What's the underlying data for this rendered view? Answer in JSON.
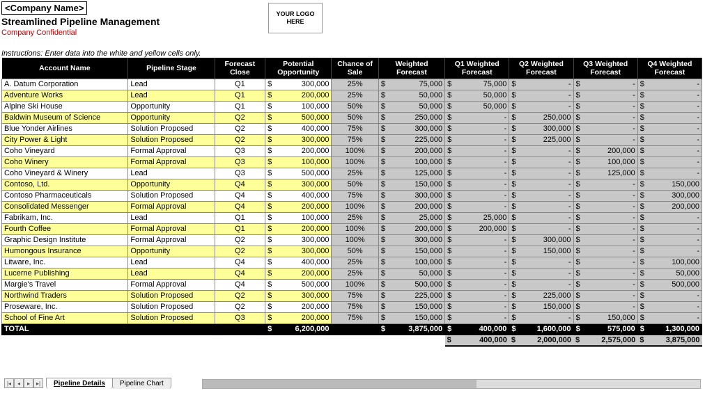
{
  "header": {
    "company_placeholder": "<Company Name>",
    "title": "Streamlined Pipeline Management",
    "confidential": "Company Confidential",
    "logo_text": "YOUR LOGO HERE",
    "instructions": "Instructions: Enter data into the white and yellow cells only."
  },
  "columns": {
    "account": "Account Name",
    "stage": "Pipeline Stage",
    "close": "Forecast Close",
    "potential": "Potential Opportunity",
    "chance": "Chance of Sale",
    "weighted": "Weighted Forecast",
    "q1": "Q1 Weighted Forecast",
    "q2": "Q2 Weighted Forecast",
    "q3": "Q3 Weighted Forecast",
    "q4": "Q4 Weighted Forecast"
  },
  "rows": [
    {
      "account": "A. Datum Corporation",
      "stage": "Lead",
      "close": "Q1",
      "potential": "300,000",
      "chance": "25%",
      "wf": "75,000",
      "q1": "75,000",
      "q2": "-",
      "q3": "-",
      "q4": "-"
    },
    {
      "account": "Adventure Works",
      "stage": "Lead",
      "close": "Q1",
      "potential": "200,000",
      "chance": "25%",
      "wf": "50,000",
      "q1": "50,000",
      "q2": "-",
      "q3": "-",
      "q4": "-"
    },
    {
      "account": "Alpine Ski House",
      "stage": "Opportunity",
      "close": "Q1",
      "potential": "100,000",
      "chance": "50%",
      "wf": "50,000",
      "q1": "50,000",
      "q2": "-",
      "q3": "-",
      "q4": "-"
    },
    {
      "account": "Baldwin Museum of Science",
      "stage": "Opportunity",
      "close": "Q2",
      "potential": "500,000",
      "chance": "50%",
      "wf": "250,000",
      "q1": "-",
      "q2": "250,000",
      "q3": "-",
      "q4": "-"
    },
    {
      "account": "Blue Yonder Airlines",
      "stage": "Solution Proposed",
      "close": "Q2",
      "potential": "400,000",
      "chance": "75%",
      "wf": "300,000",
      "q1": "-",
      "q2": "300,000",
      "q3": "-",
      "q4": "-"
    },
    {
      "account": "City Power & Light",
      "stage": "Solution Proposed",
      "close": "Q2",
      "potential": "300,000",
      "chance": "75%",
      "wf": "225,000",
      "q1": "-",
      "q2": "225,000",
      "q3": "-",
      "q4": "-"
    },
    {
      "account": "Coho Vineyard",
      "stage": "Formal Approval",
      "close": "Q3",
      "potential": "200,000",
      "chance": "100%",
      "wf": "200,000",
      "q1": "-",
      "q2": "-",
      "q3": "200,000",
      "q4": "-"
    },
    {
      "account": "Coho Winery",
      "stage": "Formal Approval",
      "close": "Q3",
      "potential": "100,000",
      "chance": "100%",
      "wf": "100,000",
      "q1": "-",
      "q2": "-",
      "q3": "100,000",
      "q4": "-"
    },
    {
      "account": "Coho Vineyard & Winery",
      "stage": "Lead",
      "close": "Q3",
      "potential": "500,000",
      "chance": "25%",
      "wf": "125,000",
      "q1": "-",
      "q2": "-",
      "q3": "125,000",
      "q4": "-"
    },
    {
      "account": "Contoso, Ltd.",
      "stage": "Opportunity",
      "close": "Q4",
      "potential": "300,000",
      "chance": "50%",
      "wf": "150,000",
      "q1": "-",
      "q2": "-",
      "q3": "-",
      "q4": "150,000"
    },
    {
      "account": "Contoso Pharmaceuticals",
      "stage": "Solution Proposed",
      "close": "Q4",
      "potential": "400,000",
      "chance": "75%",
      "wf": "300,000",
      "q1": "-",
      "q2": "-",
      "q3": "-",
      "q4": "300,000"
    },
    {
      "account": "Consolidated Messenger",
      "stage": "Formal Approval",
      "close": "Q4",
      "potential": "200,000",
      "chance": "100%",
      "wf": "200,000",
      "q1": "-",
      "q2": "-",
      "q3": "-",
      "q4": "200,000"
    },
    {
      "account": "Fabrikam, Inc.",
      "stage": "Lead",
      "close": "Q1",
      "potential": "100,000",
      "chance": "25%",
      "wf": "25,000",
      "q1": "25,000",
      "q2": "-",
      "q3": "-",
      "q4": "-"
    },
    {
      "account": "Fourth Coffee",
      "stage": "Formal Approval",
      "close": "Q1",
      "potential": "200,000",
      "chance": "100%",
      "wf": "200,000",
      "q1": "200,000",
      "q2": "-",
      "q3": "-",
      "q4": "-"
    },
    {
      "account": "Graphic Design Institute",
      "stage": "Formal Approval",
      "close": "Q2",
      "potential": "300,000",
      "chance": "100%",
      "wf": "300,000",
      "q1": "-",
      "q2": "300,000",
      "q3": "-",
      "q4": "-"
    },
    {
      "account": "Humongous Insurance",
      "stage": "Opportunity",
      "close": "Q2",
      "potential": "300,000",
      "chance": "50%",
      "wf": "150,000",
      "q1": "-",
      "q2": "150,000",
      "q3": "-",
      "q4": "-"
    },
    {
      "account": "Litware, Inc.",
      "stage": "Lead",
      "close": "Q4",
      "potential": "400,000",
      "chance": "25%",
      "wf": "100,000",
      "q1": "-",
      "q2": "-",
      "q3": "-",
      "q4": "100,000"
    },
    {
      "account": "Lucerne Publishing",
      "stage": "Lead",
      "close": "Q4",
      "potential": "200,000",
      "chance": "25%",
      "wf": "50,000",
      "q1": "-",
      "q2": "-",
      "q3": "-",
      "q4": "50,000"
    },
    {
      "account": "Margie's Travel",
      "stage": "Formal Approval",
      "close": "Q4",
      "potential": "500,000",
      "chance": "100%",
      "wf": "500,000",
      "q1": "-",
      "q2": "-",
      "q3": "-",
      "q4": "500,000"
    },
    {
      "account": "Northwind Traders",
      "stage": "Solution Proposed",
      "close": "Q2",
      "potential": "300,000",
      "chance": "75%",
      "wf": "225,000",
      "q1": "-",
      "q2": "225,000",
      "q3": "-",
      "q4": "-"
    },
    {
      "account": "Proseware, Inc.",
      "stage": "Solution Proposed",
      "close": "Q2",
      "potential": "200,000",
      "chance": "75%",
      "wf": "150,000",
      "q1": "-",
      "q2": "150,000",
      "q3": "-",
      "q4": "-"
    },
    {
      "account": "School of Fine Art",
      "stage": "Solution Proposed",
      "close": "Q3",
      "potential": "200,000",
      "chance": "75%",
      "wf": "150,000",
      "q1": "-",
      "q2": "-",
      "q3": "150,000",
      "q4": "-"
    }
  ],
  "total": {
    "label": "TOTAL",
    "potential": "6,200,000",
    "wf": "3,875,000",
    "q1": "400,000",
    "q2": "1,600,000",
    "q3": "575,000",
    "q4": "1,300,000"
  },
  "grand": {
    "q1": "400,000",
    "q2": "2,000,000",
    "q3": "2,575,000",
    "q4": "3,875,000"
  },
  "tabs": {
    "active": "Pipeline Details",
    "other": "Pipeline Chart"
  },
  "chart_data": {
    "type": "table",
    "title": "Streamlined Pipeline Management",
    "columns": [
      "Account Name",
      "Pipeline Stage",
      "Forecast Close",
      "Potential Opportunity",
      "Chance of Sale",
      "Weighted Forecast",
      "Q1 Weighted Forecast",
      "Q2 Weighted Forecast",
      "Q3 Weighted Forecast",
      "Q4 Weighted Forecast"
    ],
    "totals": {
      "potential": 6200000,
      "weighted": 3875000,
      "q1": 400000,
      "q2": 1600000,
      "q3": 575000,
      "q4": 1300000
    },
    "cumulative": {
      "q1": 400000,
      "q2": 2000000,
      "q3": 2575000,
      "q4": 3875000
    }
  }
}
